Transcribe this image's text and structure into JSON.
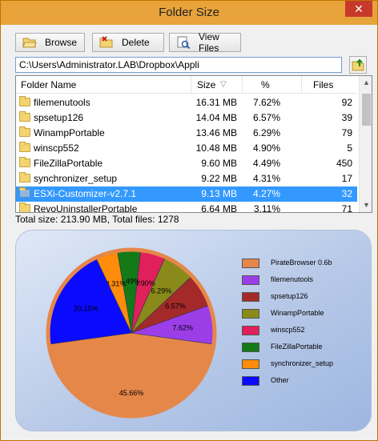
{
  "window": {
    "title": "Folder Size",
    "close_glyph": "✕"
  },
  "toolbar": {
    "browse": "Browse",
    "delete": "Delete",
    "view_files": "View Files"
  },
  "path": {
    "value": "C:\\Users\\Administrator.LAB\\Dropbox\\Appli"
  },
  "list": {
    "headers": {
      "name": "Folder Name",
      "size": "Size",
      "pct": "%",
      "files": "Files",
      "sort_glyph": "▽"
    },
    "rows": [
      {
        "name": "filemenutools",
        "size": "16.31 MB",
        "pct": "7.62%",
        "files": "92"
      },
      {
        "name": "spsetup126",
        "size": "14.04 MB",
        "pct": "6.57%",
        "files": "39"
      },
      {
        "name": "WinampPortable",
        "size": "13.46 MB",
        "pct": "6.29%",
        "files": "79"
      },
      {
        "name": "winscp552",
        "size": "10.48 MB",
        "pct": "4.90%",
        "files": "5"
      },
      {
        "name": "FileZillaPortable",
        "size": "9.60 MB",
        "pct": "4.49%",
        "files": "450"
      },
      {
        "name": "synchronizer_setup",
        "size": "9.22 MB",
        "pct": "4.31%",
        "files": "17"
      },
      {
        "name": "ESXi-Customizer-v2.7.1",
        "size": "9.13 MB",
        "pct": "4.27%",
        "files": "32"
      },
      {
        "name": "RevoUninstallerPortable",
        "size": "6.64 MB",
        "pct": "3.11%",
        "files": "71"
      }
    ],
    "selected_index": 6
  },
  "status": {
    "text": "Total size: 213.90 MB, Total files: 1278"
  },
  "chart_data": {
    "type": "pie",
    "slices": [
      {
        "name": "PirateBrowser 0.6b",
        "value": 45.66,
        "label": "45.66%",
        "color": "#e6874a"
      },
      {
        "name": "filemenutools",
        "value": 7.62,
        "label": "7.62%",
        "color": "#9b3ee8"
      },
      {
        "name": "spsetup126",
        "value": 6.57,
        "label": "6.57%",
        "color": "#a42a2a"
      },
      {
        "name": "WinampPortable",
        "value": 6.29,
        "label": "6.29%",
        "color": "#8a8a1a"
      },
      {
        "name": "winscp552",
        "value": 4.9,
        "label": "4.90%",
        "color": "#e0205a"
      },
      {
        "name": "FileZillaPortable",
        "value": 4.49,
        "label": "4.49%",
        "color": "#137a17"
      },
      {
        "name": "synchronizer_setup",
        "value": 4.31,
        "label": "4.31%",
        "color": "#ff8c0a"
      },
      {
        "name": "Other",
        "value": 20.15,
        "label": "20.15%",
        "color": "#0a0aff"
      }
    ]
  }
}
